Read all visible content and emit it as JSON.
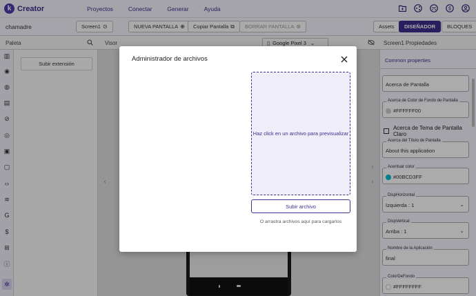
{
  "app": {
    "name": "Creator",
    "logo_letter": "k"
  },
  "nav": [
    "Proyectos",
    "Conectar",
    "Generar",
    "Ayuda"
  ],
  "top_icons": [
    "folder-icon",
    "share-icon",
    "github-icon",
    "dollar-icon",
    "user-icon"
  ],
  "toolbar": {
    "project": "chamadre",
    "screen": "Screen1",
    "new_screen": "NUEVA PANTALLA",
    "copy_screen": "Copiar Pantalla",
    "delete_screen": "BORRAR PANTALLA",
    "assets": "Assets",
    "designer": "DISEÑADOR",
    "blocks": "BLOQUES"
  },
  "panels": {
    "palette": "Paleta",
    "viewer": "Visor",
    "device": "Google Pixel 3",
    "properties_title": "Screen1 Propiedades"
  },
  "palette": {
    "upload_extension": "Subir extensión"
  },
  "properties": {
    "common": "Common properties",
    "about_screen": "Acerca de Pantalla",
    "bg_color_label": "Acerca de Color de Fondo de Pantalla",
    "bg_color_value": "#FFFFFF00",
    "theme_light": "Acerca de Tema de Pantalla Claro",
    "title_label": "Acerca del Título de Pantalla",
    "title_value": "About this application",
    "accent_label": "Acentuar color",
    "accent_value": "#00BCD3FF",
    "h_align_label": "DispHorizontal",
    "h_align_value": "Izquierda : 1",
    "v_align_label": "DispVertical",
    "v_align_value": "Arriba : 1",
    "app_name_label": "Nombre de la Aplicación",
    "app_name_value": "final",
    "bg_label": "ColorDeFondo",
    "bg_value": "#FFFFFFFF"
  },
  "colors": {
    "brand": "#3b2f8c",
    "accent_swatch": "#00BCD3",
    "transparent_swatch": "#cccccc",
    "white_swatch": "#ffffff"
  },
  "modal": {
    "title": "Administrador de archivos",
    "preview_hint": "Haz click en un archivo para previsualizar",
    "upload_button": "Subir archivo",
    "drag_hint": "O arrastra archivos aquí para cargarlos"
  }
}
